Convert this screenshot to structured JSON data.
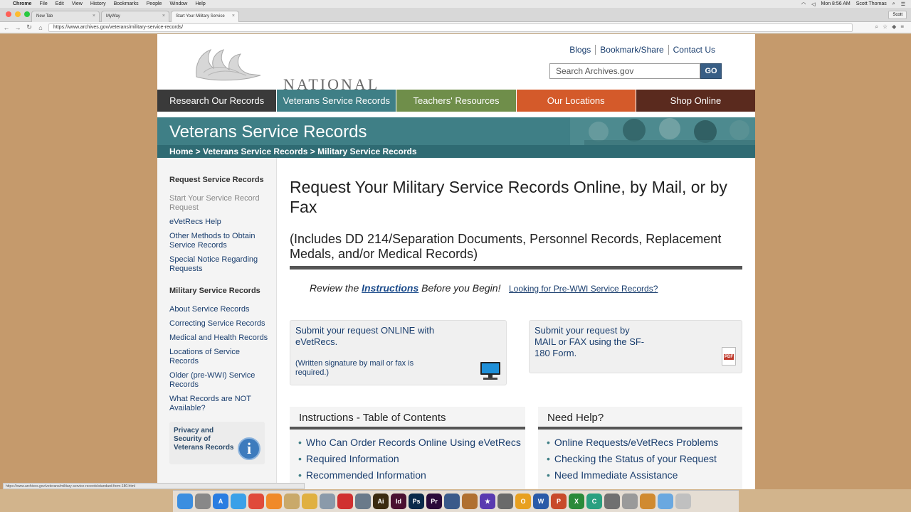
{
  "menubar": {
    "app": "Chrome",
    "items": [
      "File",
      "Edit",
      "View",
      "History",
      "Bookmarks",
      "People",
      "Window",
      "Help"
    ],
    "clock": "Mon 8:56 AM",
    "user": "Scott Thomas"
  },
  "browser": {
    "tabs": [
      {
        "label": "New Tab"
      },
      {
        "label": "MyWay"
      },
      {
        "label": "Start Your Military Service"
      }
    ],
    "profile": "Scott",
    "url": "https://www.archives.gov/veterans/military-service-records/"
  },
  "site": {
    "logo_text": "NATIONAL ARCHIVES",
    "top_links": [
      "Blogs",
      "Bookmark/Share",
      "Contact Us"
    ],
    "search_placeholder": "Search Archives.gov",
    "go_label": "GO",
    "nav": [
      {
        "label": "Research Our Records",
        "color": "#3a3a3a"
      },
      {
        "label": "Veterans Service Records",
        "color": "#3f7f86"
      },
      {
        "label": "Teachers' Resources",
        "color": "#6f8e4a"
      },
      {
        "label": "Our Locations",
        "color": "#d45a2a"
      },
      {
        "label": "Shop Online",
        "color": "#5a2a1e"
      }
    ],
    "banner_title": "Veterans Service Records",
    "breadcrumb": "Home >  Veterans Service Records >  Military Service Records"
  },
  "sidebar": {
    "heading1": "Request Service Records",
    "links1": [
      "Start Your Service Record Request",
      "eVetRecs Help",
      "Other Methods to Obtain Service Records",
      "Special Notice Regarding Requests"
    ],
    "heading2": "Military Service Records",
    "links2": [
      "About Service Records",
      "Correcting Service Records",
      "Medical and Health Records",
      "Locations of Service Records",
      "Older (pre-WWI) Service Records",
      "What Records are NOT Available?"
    ],
    "privacy_box": "Privacy and Security of Veterans Records",
    "info_glyph": "i"
  },
  "main": {
    "title": "Request Your Military Service Records Online, by Mail, or by Fax",
    "subtitle": "(Includes DD 214/Separation Documents, Personnel Records, Replacement Medals, and/or Medical Records)",
    "review_pre": "Review the ",
    "review_link": "Instructions",
    "review_post": " Before you Begin!",
    "pre_wwi_link": "Looking for Pre-WWI Service Records?",
    "card_online": {
      "title": "Submit your request ONLINE with eVetRecs.",
      "subtext": "(Written signature by mail or fax is required.)"
    },
    "card_mail": {
      "title": "Submit your request by MAIL or FAX using the SF-180 Form.",
      "badge": "PDF"
    },
    "toc": {
      "heading": "Instructions - Table of Contents",
      "items": [
        "Who Can Order Records Online Using eVetRecs",
        "Required Information",
        "Recommended Information"
      ]
    },
    "help": {
      "heading": "Need Help?",
      "items": [
        "Online Requests/eVetRecs Problems",
        "Checking the Status of your Request",
        "Need Immediate Assistance"
      ]
    }
  },
  "statusbar": "https://www.archives.gov/veterans/military-service-records/standard-form-180.html",
  "dock": [
    {
      "name": "finder",
      "color": "#3b8ee0",
      "glyph": ""
    },
    {
      "name": "launchpad",
      "color": "#888888",
      "glyph": ""
    },
    {
      "name": "app-store",
      "color": "#2a7de1",
      "glyph": "A"
    },
    {
      "name": "safari",
      "color": "#3aa0e8",
      "glyph": ""
    },
    {
      "name": "chrome",
      "color": "#e04a3a",
      "glyph": ""
    },
    {
      "name": "ibooks",
      "color": "#f08a2a",
      "glyph": ""
    },
    {
      "name": "notes",
      "color": "#c9a96a",
      "glyph": ""
    },
    {
      "name": "photos",
      "color": "#e0b040",
      "glyph": ""
    },
    {
      "name": "preview",
      "color": "#8a9aaa",
      "glyph": ""
    },
    {
      "name": "acrobat",
      "color": "#d03030",
      "glyph": ""
    },
    {
      "name": "scanner",
      "color": "#6a7a8a",
      "glyph": ""
    },
    {
      "name": "illustrator",
      "color": "#3a2a10",
      "glyph": "Ai"
    },
    {
      "name": "indesign",
      "color": "#4a1030",
      "glyph": "Id"
    },
    {
      "name": "photoshop",
      "color": "#0a2a4a",
      "glyph": "Ps"
    },
    {
      "name": "premiere",
      "color": "#2a0a3a",
      "glyph": "Pr"
    },
    {
      "name": "video",
      "color": "#3a5a8a",
      "glyph": ""
    },
    {
      "name": "guitar",
      "color": "#b07030",
      "glyph": ""
    },
    {
      "name": "star",
      "color": "#5a3ab0",
      "glyph": "★"
    },
    {
      "name": "gear",
      "color": "#6a6a6a",
      "glyph": ""
    },
    {
      "name": "outlook",
      "color": "#e8a020",
      "glyph": "O"
    },
    {
      "name": "word",
      "color": "#2a5aa8",
      "glyph": "W"
    },
    {
      "name": "powerpoint",
      "color": "#c84a2a",
      "glyph": "P"
    },
    {
      "name": "excel",
      "color": "#2a8a3a",
      "glyph": "X"
    },
    {
      "name": "camtasia",
      "color": "#2aa080",
      "glyph": "C"
    },
    {
      "name": "system-prefs",
      "color": "#707070",
      "glyph": ""
    },
    {
      "name": "documents",
      "color": "#9a9a9a",
      "glyph": ""
    },
    {
      "name": "pages",
      "color": "#d08a30",
      "glyph": ""
    },
    {
      "name": "folder",
      "color": "#6aa8e0",
      "glyph": ""
    },
    {
      "name": "trash",
      "color": "#c0c0c0",
      "glyph": ""
    }
  ]
}
